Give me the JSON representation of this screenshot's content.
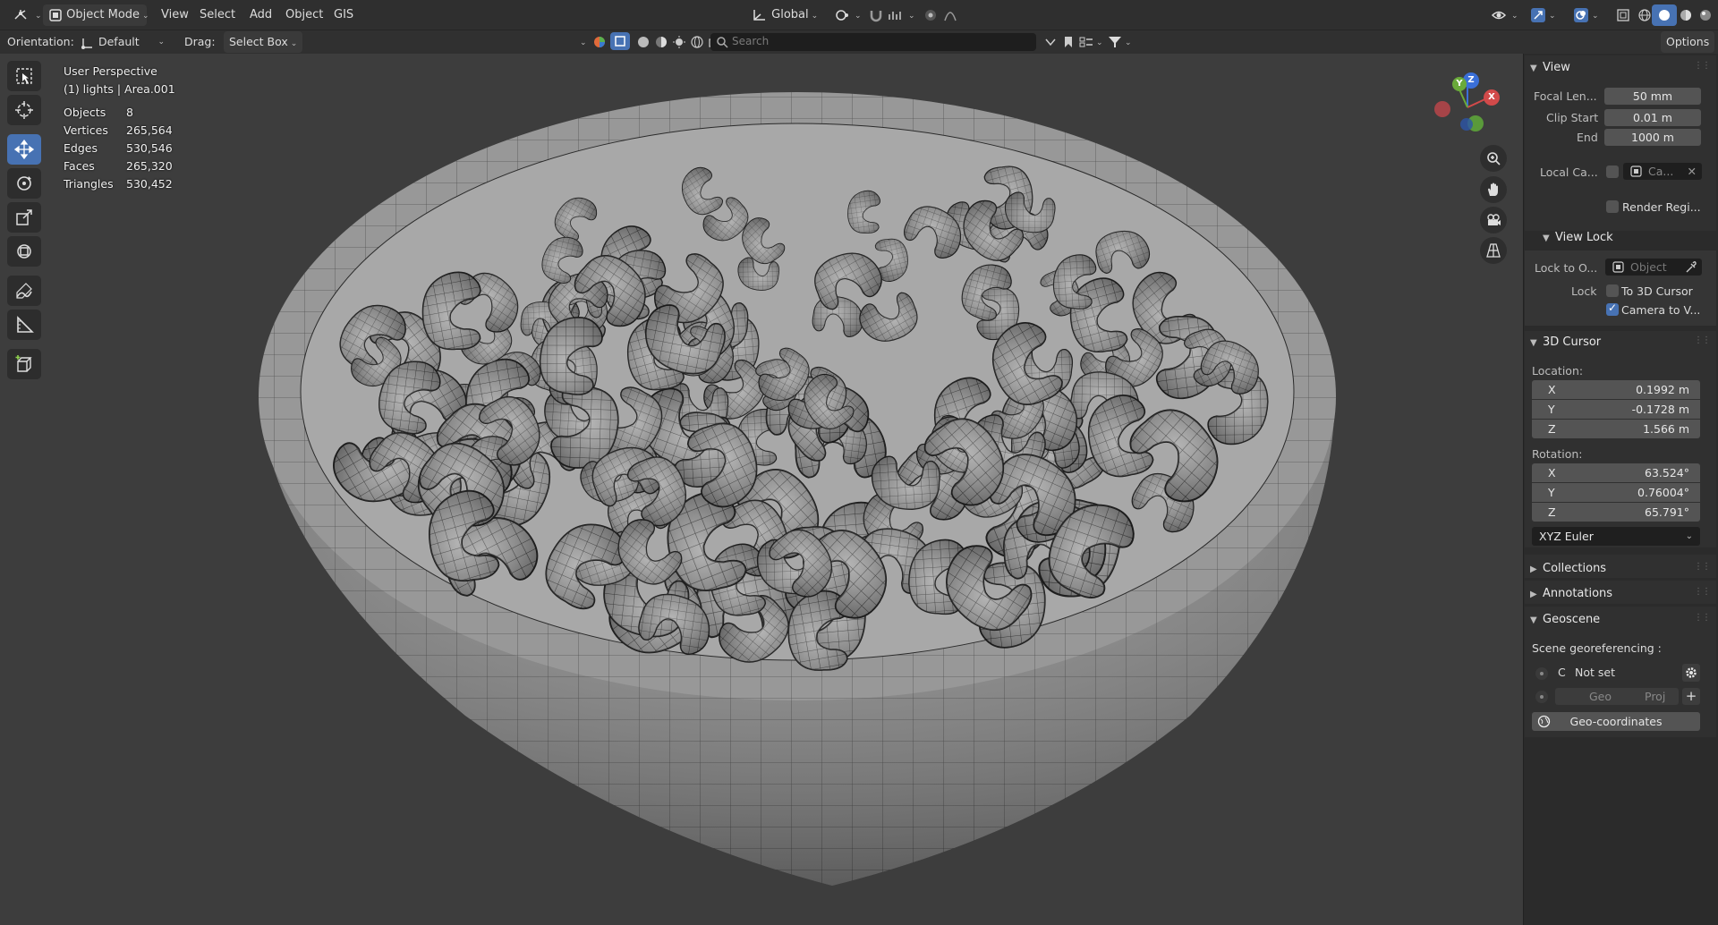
{
  "header": {
    "mode": "Object Mode",
    "menus": [
      "View",
      "Select",
      "Add",
      "Object",
      "GIS"
    ],
    "transform_orientation": "Global",
    "options_label": "Options"
  },
  "toolbar2": {
    "orientation_label": "Orientation:",
    "orientation_value": "Default",
    "drag_label": "Drag:",
    "drag_value": "Select Box",
    "search_placeholder": "Search"
  },
  "stats": {
    "view_name": "User Perspective",
    "collection": "(1) lights | Area.001",
    "rows": [
      {
        "label": "Objects",
        "value": "8"
      },
      {
        "label": "Vertices",
        "value": "265,564"
      },
      {
        "label": "Edges",
        "value": "530,546"
      },
      {
        "label": "Faces",
        "value": "265,320"
      },
      {
        "label": "Triangles",
        "value": "530,452"
      }
    ]
  },
  "gizmo": {
    "x": "X",
    "y": "Y",
    "z": "Z"
  },
  "sidebar": {
    "view": {
      "title": "View",
      "focal_label": "Focal Len...",
      "focal_value": "50 mm",
      "clip_start_label": "Clip Start",
      "clip_start_value": "0.01 m",
      "clip_end_label": "End",
      "clip_end_value": "1000 m",
      "local_camera_label": "Local Ca...",
      "local_camera_value": "Ca...",
      "render_region_label": "Render Regi..."
    },
    "view_lock": {
      "title": "View Lock",
      "lock_to_object_label": "Lock to O...",
      "lock_to_object_placeholder": "Object",
      "lock_label": "Lock",
      "to_3d_cursor_label": "To 3D Cursor",
      "camera_to_view_label": "Camera to V..."
    },
    "cursor": {
      "title": "3D Cursor",
      "location_label": "Location:",
      "location": [
        {
          "axis": "X",
          "value": "0.1992 m"
        },
        {
          "axis": "Y",
          "value": "-0.1728 m"
        },
        {
          "axis": "Z",
          "value": "1.566 m"
        }
      ],
      "rotation_label": "Rotation:",
      "rotation": [
        {
          "axis": "X",
          "value": "63.524°"
        },
        {
          "axis": "Y",
          "value": "0.76004°"
        },
        {
          "axis": "Z",
          "value": "65.791°"
        }
      ],
      "rotation_mode": "XYZ Euler"
    },
    "collapsed_panels": [
      "Collections",
      "Annotations"
    ],
    "geoscene": {
      "title": "Geoscene",
      "georef_label": "Scene georeferencing :",
      "crs_letter": "C",
      "crs_value": "Not set",
      "geo_label": "Geo",
      "proj_label": "Proj",
      "geo_coordinates_label": "Geo-coordinates"
    }
  }
}
